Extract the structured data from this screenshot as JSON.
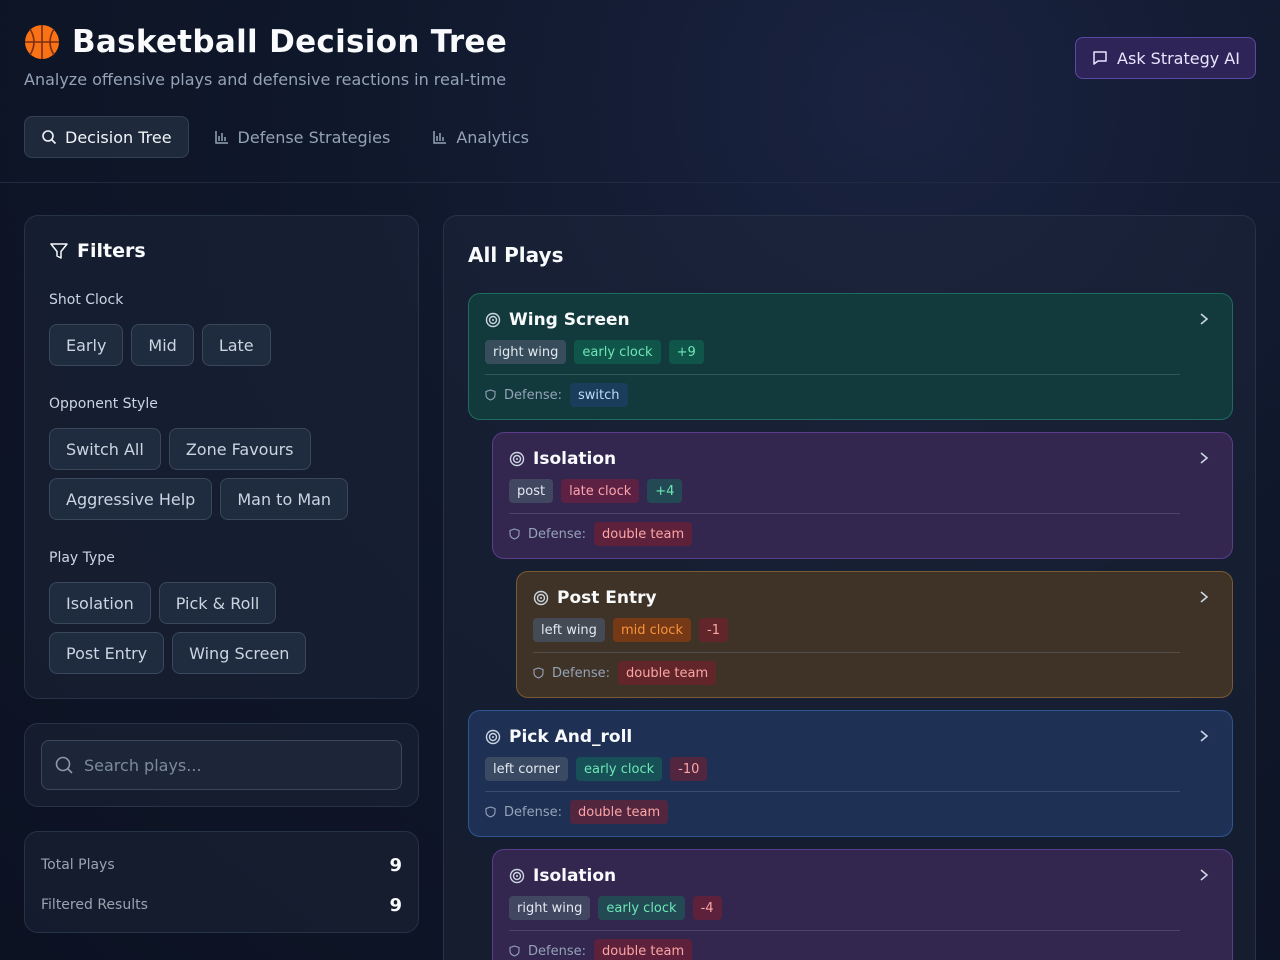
{
  "header": {
    "title": "Basketball Decision Tree",
    "subtitle": "Analyze offensive plays and defensive reactions in real-time",
    "ask_button": "Ask Strategy AI"
  },
  "tabs": [
    {
      "label": "Decision Tree",
      "icon": "search-icon",
      "active": true
    },
    {
      "label": "Defense Strategies",
      "icon": "bar-chart-icon",
      "active": false
    },
    {
      "label": "Analytics",
      "icon": "bar-chart-icon",
      "active": false
    }
  ],
  "filters": {
    "title": "Filters",
    "shot_clock": {
      "label": "Shot Clock",
      "options": [
        "Early",
        "Mid",
        "Late"
      ]
    },
    "opponent_style": {
      "label": "Opponent Style",
      "options": [
        "Switch All",
        "Zone Favours",
        "Aggressive Help",
        "Man to Man"
      ]
    },
    "play_type": {
      "label": "Play Type",
      "options": [
        "Isolation",
        "Pick & Roll",
        "Post Entry",
        "Wing Screen"
      ]
    }
  },
  "search": {
    "placeholder": "Search plays..."
  },
  "stats": {
    "total_label": "Total Plays",
    "total_value": "9",
    "filtered_label": "Filtered Results",
    "filtered_value": "9"
  },
  "plays_panel": {
    "title": "All Plays",
    "defense_label": "Defense:",
    "plays": [
      {
        "name": "Wing Screen",
        "position": "right wing",
        "clock": "early clock",
        "score": "+9",
        "defense": "switch",
        "theme": "teal"
      },
      {
        "name": "Isolation",
        "position": "post",
        "clock": "late clock",
        "score": "+4",
        "defense": "double team",
        "theme": "purple"
      },
      {
        "name": "Post Entry",
        "position": "left wing",
        "clock": "mid clock",
        "score": "-1",
        "defense": "double team",
        "theme": "brown"
      },
      {
        "name": "Pick And_roll",
        "position": "left corner",
        "clock": "early clock",
        "score": "-10",
        "defense": "double team",
        "theme": "blue"
      },
      {
        "name": "Isolation",
        "position": "right wing",
        "clock": "early clock",
        "score": "-4",
        "defense": "double team",
        "theme": "purple"
      }
    ]
  },
  "colors": {
    "teal_bg": "#123a3c",
    "teal_border": "#1f6b5e",
    "purple_bg": "#33264f",
    "purple_border": "#5b3d8a",
    "brown_bg": "#3f3226",
    "brown_border": "#7a5a32",
    "blue_bg": "#1e3155",
    "blue_border": "#2f5590"
  }
}
